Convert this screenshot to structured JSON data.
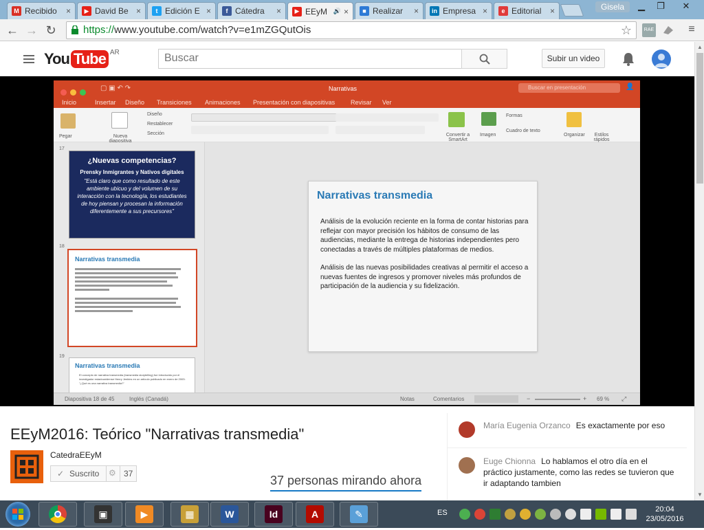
{
  "browser": {
    "tabs": [
      {
        "label": "Recibido",
        "favicon": "gmail-icon",
        "color": "#d93025",
        "letter": "M"
      },
      {
        "label": "David Be",
        "favicon": "youtube-icon",
        "color": "#e62117",
        "letter": "▶"
      },
      {
        "label": "Edición E",
        "favicon": "twitter-icon",
        "color": "#1da1f2",
        "letter": "t"
      },
      {
        "label": "Cátedra",
        "favicon": "facebook-icon",
        "color": "#3b5998",
        "letter": "f"
      },
      {
        "label": "EEyM",
        "favicon": "youtube-icon",
        "color": "#e62117",
        "letter": "▶",
        "active": true
      },
      {
        "label": "Realizar",
        "favicon": "microsoft-icon",
        "color": "#2d7ad6",
        "letter": "■"
      },
      {
        "label": "Empresa",
        "favicon": "linkedin-icon",
        "color": "#0077b5",
        "letter": "in"
      },
      {
        "label": "Editorial",
        "favicon": "editorial-icon",
        "color": "#e03a3a",
        "letter": "e"
      }
    ],
    "user": "Gisela",
    "url_scheme": "https://",
    "url_rest": "www.youtube.com/watch?v=e1mZGQutOis"
  },
  "youtube": {
    "country": "AR",
    "logo_you": "You",
    "logo_tube": "Tube",
    "search_placeholder": "Buscar",
    "upload_label": "Subir un video"
  },
  "powerpoint": {
    "window_title": "Narrativas",
    "search_placeholder": "Buscar en presentación",
    "ribbon_tabs": [
      "Inicio",
      "Insertar",
      "Diseño",
      "Transiciones",
      "Animaciones",
      "Presentación con diapositivas",
      "Revisar",
      "Ver"
    ],
    "ribbon_labels": {
      "paste": "Pegar",
      "new_slide": "Nueva diapositiva",
      "layout": "Diseño",
      "reset": "Restablecer",
      "section": "Sección",
      "convert": "Convertir a SmartArt",
      "image": "Imagen",
      "shapes": "Formas",
      "textbox": "Cuadro de texto",
      "arrange": "Organizar",
      "quick_styles": "Estilos rápidos"
    },
    "thumbnails": [
      {
        "number": "17",
        "title": "¿Nuevas competencias?",
        "subtitle": "Prensky Inmigrantes y Nativos digitales",
        "quote": "\"Está claro que como resultado de este ambiente ubicuo y del volumen de su interacción con la tecnología, los estudiantes de hoy piensan y procesan la información diferentemente a sus precursores\""
      },
      {
        "number": "18",
        "title": "Narrativas transmedia"
      },
      {
        "number": "19",
        "title": "Narrativas transmedia",
        "bullet": "El concepto de narrativa transmedia (transmedia storytelling) fue introducido por el investigador estadounidense Henry Jenkins en un artículo publicado en enero de 2003: \"¿Qué es una narrativa transmedia?\""
      }
    ],
    "main_slide": {
      "title": "Narrativas transmedia",
      "para1": "Análisis de la evolución reciente en la forma de contar historias para reflejar con mayor precisión los hábitos de consumo de las audiencias, mediante la entrega de historias independientes pero conectadas a través de múltiples plataformas de medios.",
      "para2": "Análisis de las nuevas posibilidades creativas al permitir el acceso a nuevas fuentes de ingresos y promover niveles más profundos de participación de la audiencia y su fidelización."
    },
    "status": {
      "slide": "Diapositiva 18 de 45",
      "language": "Inglés (Canadá)",
      "notes": "Notas",
      "comments": "Comentarios",
      "zoom": "69 %"
    }
  },
  "video": {
    "title": "EEyM2016: Teórico \"Narrativas transmedia\"",
    "channel": "CatedraEEyM",
    "subscribe_label": "Suscrito",
    "subscriber_count": "37",
    "watching": "37 personas mirando ahora"
  },
  "chat": [
    {
      "author": "María Eugenia Orzanco",
      "text": "Es exactamente por eso",
      "avatar_color": "#b23a2a"
    },
    {
      "author": "Euge Chionna",
      "text": "Lo hablamos el otro día en el práctico justamente, como las redes se tuvieron que ir adaptando tambien",
      "avatar_color": "#a07050"
    }
  ],
  "taskbar": {
    "apps": [
      {
        "name": "chrome-icon",
        "color": "#db4437",
        "letter": ""
      },
      {
        "name": "video-capture-icon",
        "color": "#333333",
        "letter": "▣"
      },
      {
        "name": "media-player-icon",
        "color": "#f08a24",
        "letter": "▶"
      },
      {
        "name": "app-icon",
        "color": "#c8a038",
        "letter": "▦"
      },
      {
        "name": "word-icon",
        "color": "#2b579a",
        "letter": "W"
      },
      {
        "name": "indesign-icon",
        "color": "#49021f",
        "letter": "Id"
      },
      {
        "name": "acrobat-icon",
        "color": "#b30b00",
        "letter": "A"
      },
      {
        "name": "paint-icon",
        "color": "#5aa0d8",
        "letter": "✎"
      }
    ],
    "language": "ES",
    "time": "20:04",
    "date": "23/05/2016"
  }
}
